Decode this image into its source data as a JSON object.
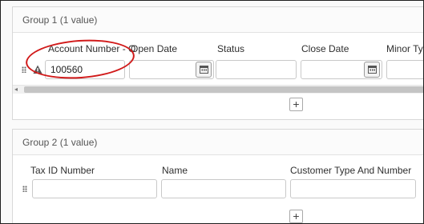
{
  "group1": {
    "title": "Group 1 (1 value)",
    "columns": [
      "Account Number - O",
      "Open Date",
      "Status",
      "Close Date",
      "Minor Typ"
    ],
    "row": {
      "account_number": "100560",
      "open_date": "",
      "status": "",
      "close_date": "",
      "minor_type": ""
    },
    "add_label": "+"
  },
  "group2": {
    "title": "Group 2 (1 value)",
    "columns": [
      "Tax ID Number",
      "Name",
      "Customer Type And Number"
    ],
    "row": {
      "tax_id": "",
      "name": "",
      "customer_type": ""
    },
    "add_label": "+"
  },
  "scroll": {
    "left_arrow": "◂"
  },
  "colors": {
    "highlight": "#d11a1a",
    "border": "#c9c9c9"
  }
}
